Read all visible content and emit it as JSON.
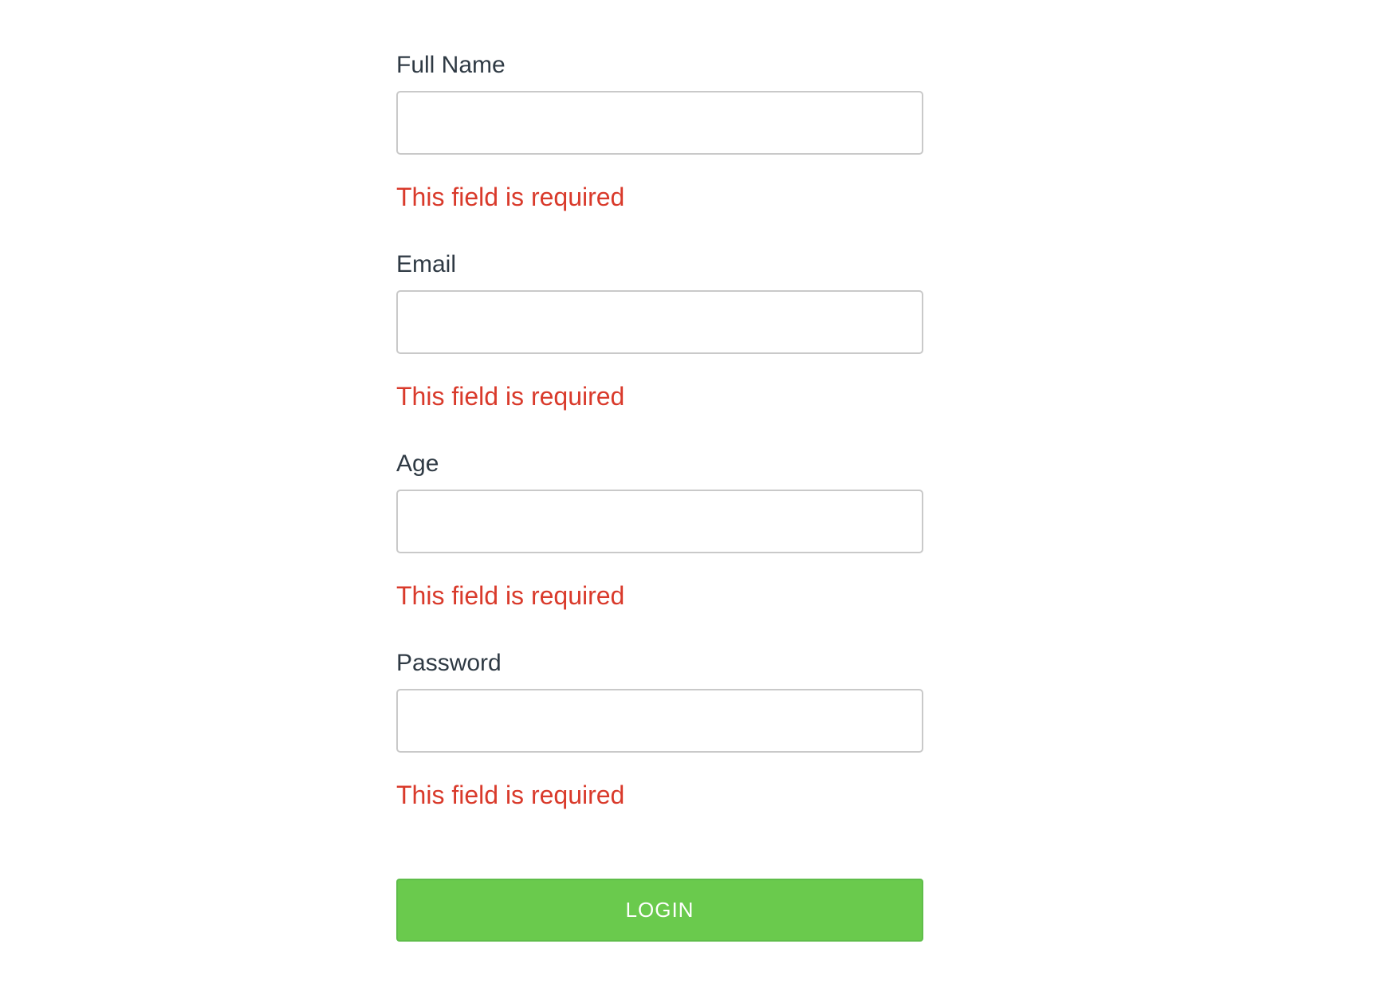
{
  "colors": {
    "error": "#d93a2b",
    "button_bg": "#6aca4d"
  },
  "form": {
    "fields": [
      {
        "label": "Full Name",
        "value": "",
        "error": "This field is required"
      },
      {
        "label": "Email",
        "value": "",
        "error": "This field is required"
      },
      {
        "label": "Age",
        "value": "",
        "error": "This field is required"
      },
      {
        "label": "Password",
        "value": "",
        "error": "This field is required"
      }
    ],
    "submit_label": "LOGIN"
  }
}
